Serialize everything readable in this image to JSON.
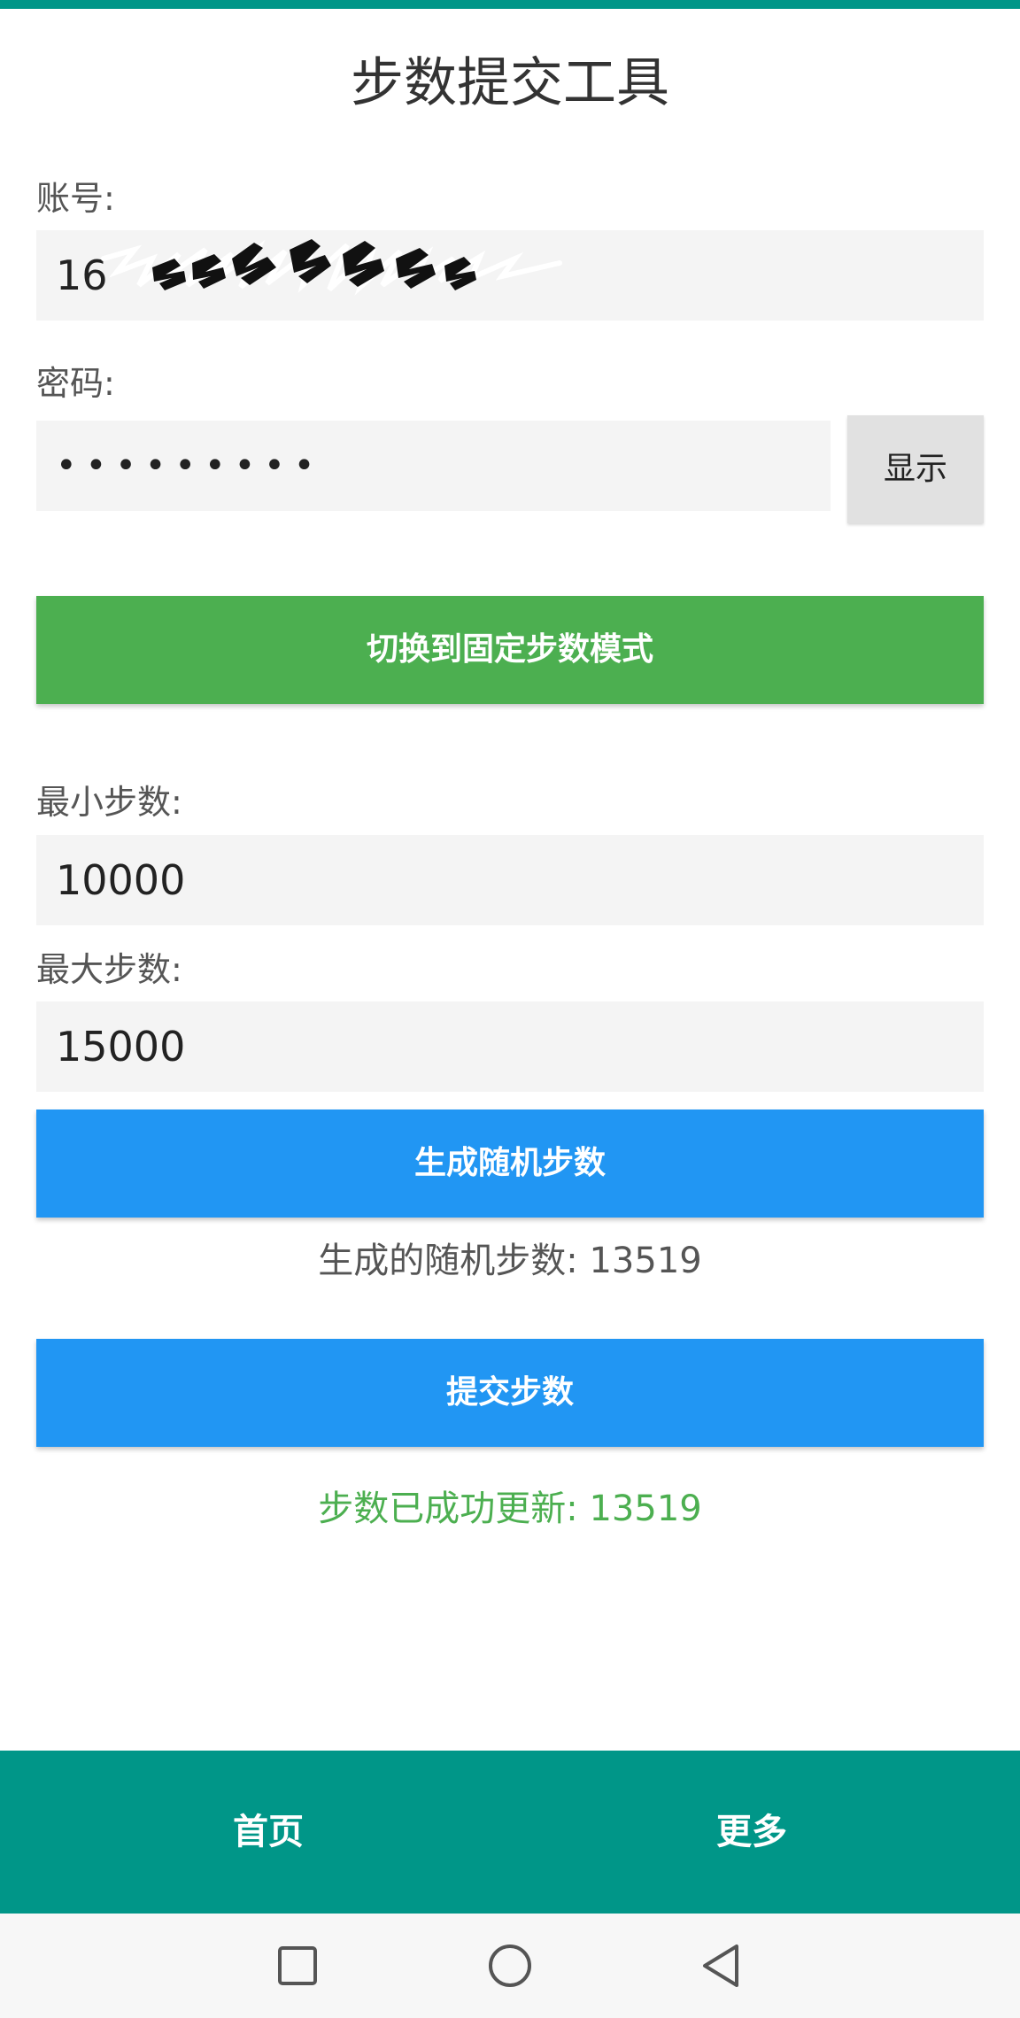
{
  "app": {
    "title": "步数提交工具"
  },
  "form": {
    "account_label": "账号:",
    "account_value": "16",
    "password_label": "密码:",
    "password_value": "•••••••••",
    "show_button": "显示",
    "mode_button": "切换到固定步数模式",
    "min_steps_label": "最小步数:",
    "min_steps_value": "10000",
    "max_steps_label": "最大步数:",
    "max_steps_value": "15000",
    "generate_button": "生成随机步数",
    "generated_text": "生成的随机步数: 13519",
    "submit_button": "提交步数",
    "success_text": "步数已成功更新: 13519"
  },
  "bottom_nav": {
    "items": [
      {
        "label": "首页"
      },
      {
        "label": "更多"
      }
    ]
  },
  "system_nav": {
    "icons": [
      "recent-apps-square-icon",
      "home-circle-icon",
      "back-triangle-icon"
    ]
  },
  "colors": {
    "primary_teal": "#009688",
    "green_button": "#4caf50",
    "blue_button": "#2196f3",
    "success_text": "#4caf50",
    "input_background": "#f4f4f4"
  }
}
